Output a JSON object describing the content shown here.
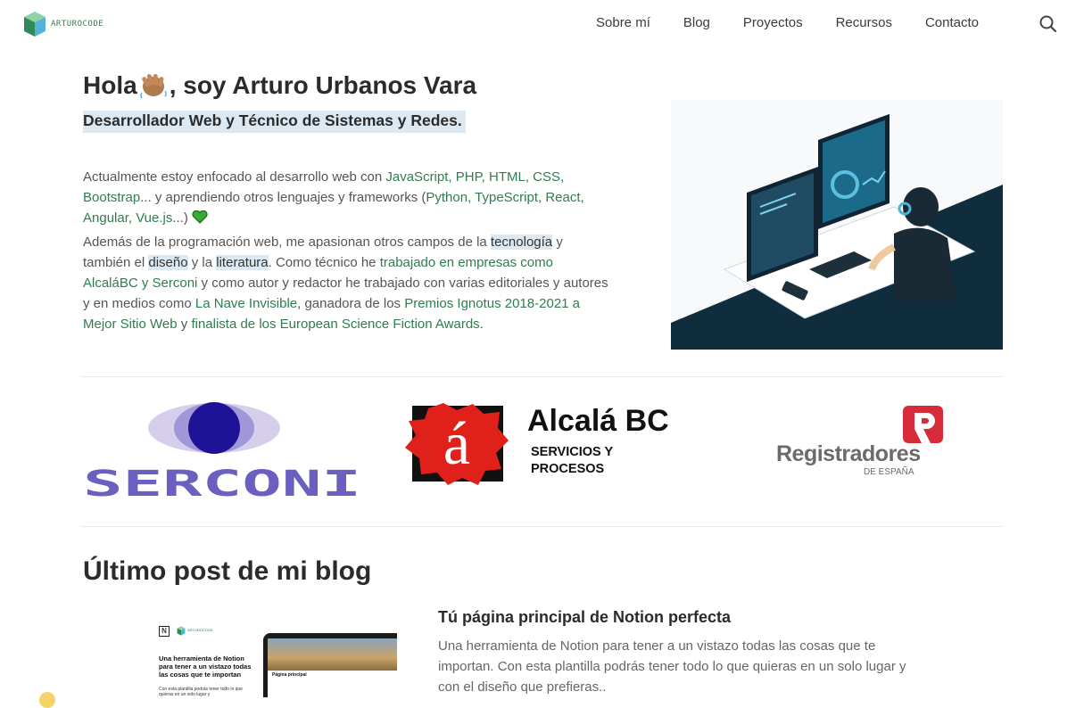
{
  "header": {
    "logo_text": "ARTUROCODE",
    "nav": [
      "Sobre mí",
      "Blog",
      "Proyectos",
      "Recursos",
      "Contacto"
    ],
    "search_icon": "search-icon"
  },
  "hero": {
    "greeting_before": "Hola ",
    "greeting_after": ", soy Arturo Urbanos Vara",
    "wave_icon": "waving-hand-emoji",
    "subtitle": "Desarrollador Web y Técnico de Sistemas y Redes.",
    "p1": {
      "t1": "Actualmente estoy enfocado al desarrollo web con ",
      "l1": "JavaScript, PHP, HTML, CSS, Bootstrap",
      "t2": "... y aprendiendo otros lenguajes y frameworks (",
      "l2": "Python, TypeScript, React, Angular, Vue.js",
      "t3": "...)"
    },
    "p2": {
      "t1": "Además de la programación web, me apasionan otros campos de la ",
      "h1": "tecnología",
      "t2": " y también el ",
      "h2": "diseño",
      "t3": " y la ",
      "h3": "literatura",
      "t4": ". Como técnico he ",
      "l1": "trabajado en empresas como AlcaláBC y Serconi",
      "t5": " y como autor y redactor he trabajado con varias editoriales y autores y en medios como ",
      "l2": "La Nave Invisible",
      "t6": ", ganadora de los ",
      "l3": "Premios Ignotus 2018-2021 a Mejor Sitio Web",
      "t7": " y ",
      "l4": "finalista de los European Science Fiction Awards",
      "t8": "."
    }
  },
  "logos": {
    "serconi": "SERCONI",
    "alcala_name": "Alcalá BC",
    "alcala_line1": "SERVICIOS Y",
    "alcala_line2": "PROCESOS",
    "alcala_mark": "á",
    "registradores": "Registradores",
    "registradores_sub": "DE ESPAÑA"
  },
  "blog": {
    "section_title": "Último post de mi blog",
    "post_title": "Tú página principal de Notion perfecta",
    "post_excerpt": "Una herramienta de Notion para tener a un vistazo todas las cosas que te importan. Con esta plantilla podrás tener todo lo que quieras en un solo lugar y con el diseño que prefieras..",
    "thumb": {
      "brand": "ARTUROCODE",
      "heading": "Una herramienta de Notion para tener a un vistazo todas las cosas que te importan",
      "body": "Con esta plantilla podrás tener todo lo que quieras en un solo lugar y",
      "screen_title": "Página principal"
    }
  }
}
